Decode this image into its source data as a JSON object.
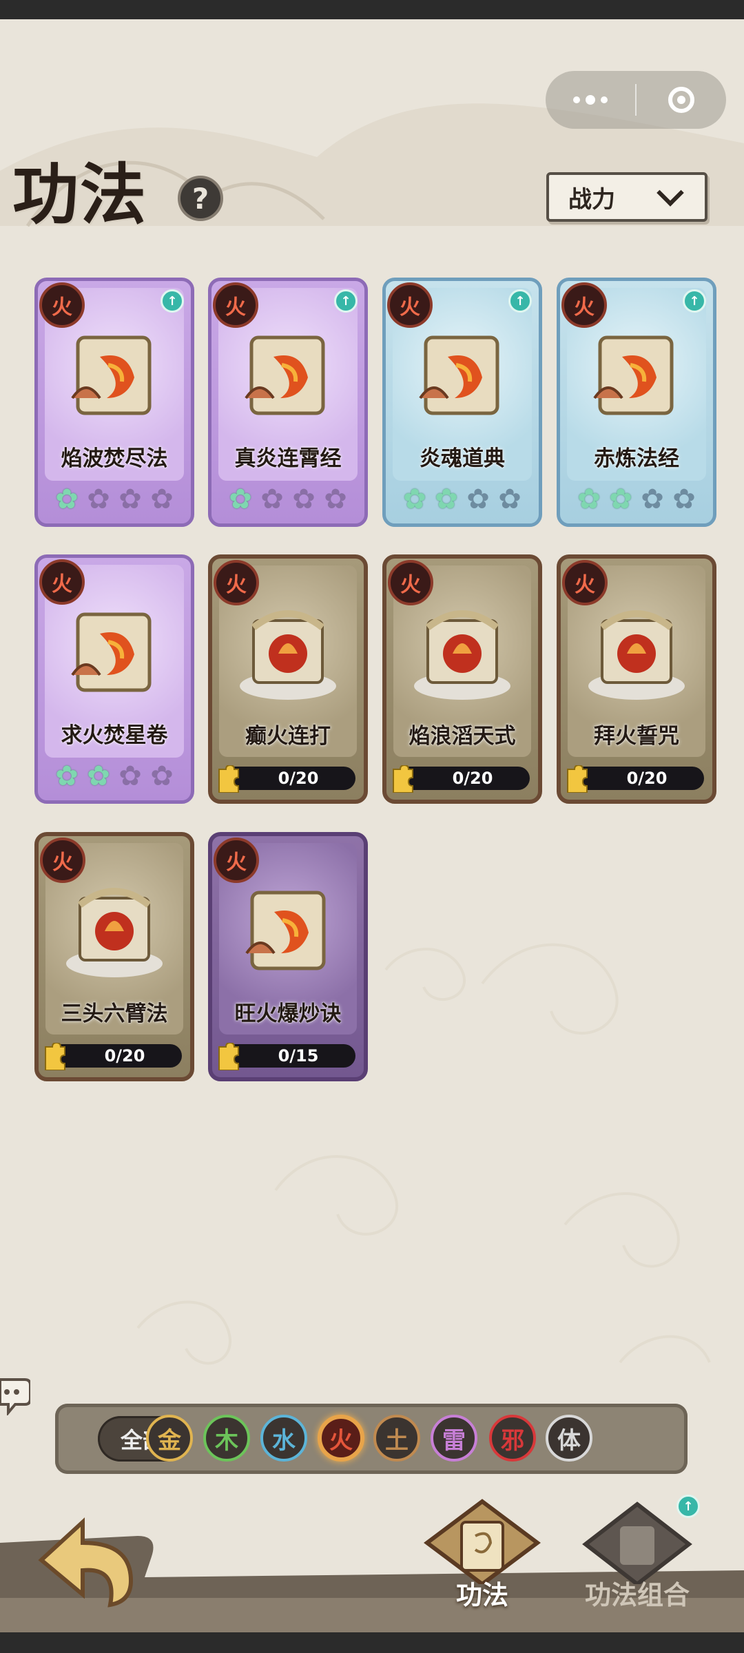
{
  "header": {
    "title": "功法",
    "help_glyph": "?",
    "sort_label": "战力"
  },
  "cards": [
    {
      "name": "焰波焚尽法",
      "element": "火",
      "frame": "purple",
      "stars_on": 1,
      "stars_total": 4,
      "upgrade": true
    },
    {
      "name": "真炎连霄经",
      "element": "火",
      "frame": "purple",
      "stars_on": 1,
      "stars_total": 4,
      "upgrade": true
    },
    {
      "name": "炎魂道典",
      "element": "火",
      "frame": "blue",
      "stars_on": 2,
      "stars_total": 4,
      "upgrade": true
    },
    {
      "name": "赤炼法经",
      "element": "火",
      "frame": "blue",
      "stars_on": 2,
      "stars_total": 4,
      "upgrade": true
    },
    {
      "name": "求火焚星卷",
      "element": "火",
      "frame": "purple",
      "stars_on": 2,
      "stars_total": 4,
      "upgrade": false
    },
    {
      "name": "癫火连打",
      "element": "火",
      "frame": "brown",
      "progress": "0/20"
    },
    {
      "name": "焰浪滔天式",
      "element": "火",
      "frame": "brown",
      "progress": "0/20"
    },
    {
      "name": "拜火誓咒",
      "element": "火",
      "frame": "brown",
      "progress": "0/20"
    },
    {
      "name": "三头六臂法",
      "element": "火",
      "frame": "brown",
      "progress": "0/20"
    },
    {
      "name": "旺火爆炒诀",
      "element": "火",
      "frame": "dpurple",
      "progress": "0/15"
    }
  ],
  "filter": {
    "all_label": "全部",
    "elements": [
      {
        "label": "金",
        "color": "#e0b450",
        "selected": false
      },
      {
        "label": "木",
        "color": "#6cc45a",
        "selected": false
      },
      {
        "label": "水",
        "color": "#5cb4d8",
        "selected": false
      },
      {
        "label": "火",
        "color": "#e4553a",
        "selected": true
      },
      {
        "label": "土",
        "color": "#c08a50",
        "selected": false
      },
      {
        "label": "雷",
        "color": "#c77fd6",
        "selected": false
      },
      {
        "label": "邪",
        "color": "#d8383a",
        "selected": false
      },
      {
        "label": "体",
        "color": "#d8d8d8",
        "selected": false
      }
    ]
  },
  "nav": {
    "tab1": "功法",
    "tab2": "功法组合"
  },
  "colors": {
    "background": "#e9e4da",
    "accent_fire": "#e4553a",
    "teal_upgrade": "#37b7a8"
  }
}
